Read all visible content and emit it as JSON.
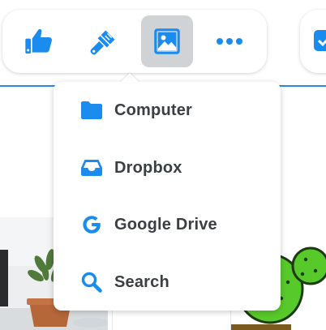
{
  "colors": {
    "accent": "#1a8cf0",
    "label": "#3b3f44",
    "active_bg": "#d0d3d6",
    "cactus_green": "#58c92a"
  },
  "toolbar": {
    "buttons": [
      {
        "name": "like",
        "icon": "thumbs-up-icon"
      },
      {
        "name": "style",
        "icon": "paintbrush-icon"
      },
      {
        "name": "image",
        "icon": "image-icon",
        "active": true
      },
      {
        "name": "more",
        "icon": "ellipsis-icon"
      }
    ]
  },
  "menu": {
    "items": [
      {
        "label": "Computer",
        "icon": "folder-icon"
      },
      {
        "label": "Dropbox",
        "icon": "dropbox-tray-icon"
      },
      {
        "label": "Google Drive",
        "icon": "google-g-icon"
      },
      {
        "label": "Search",
        "icon": "search-icon"
      }
    ]
  }
}
